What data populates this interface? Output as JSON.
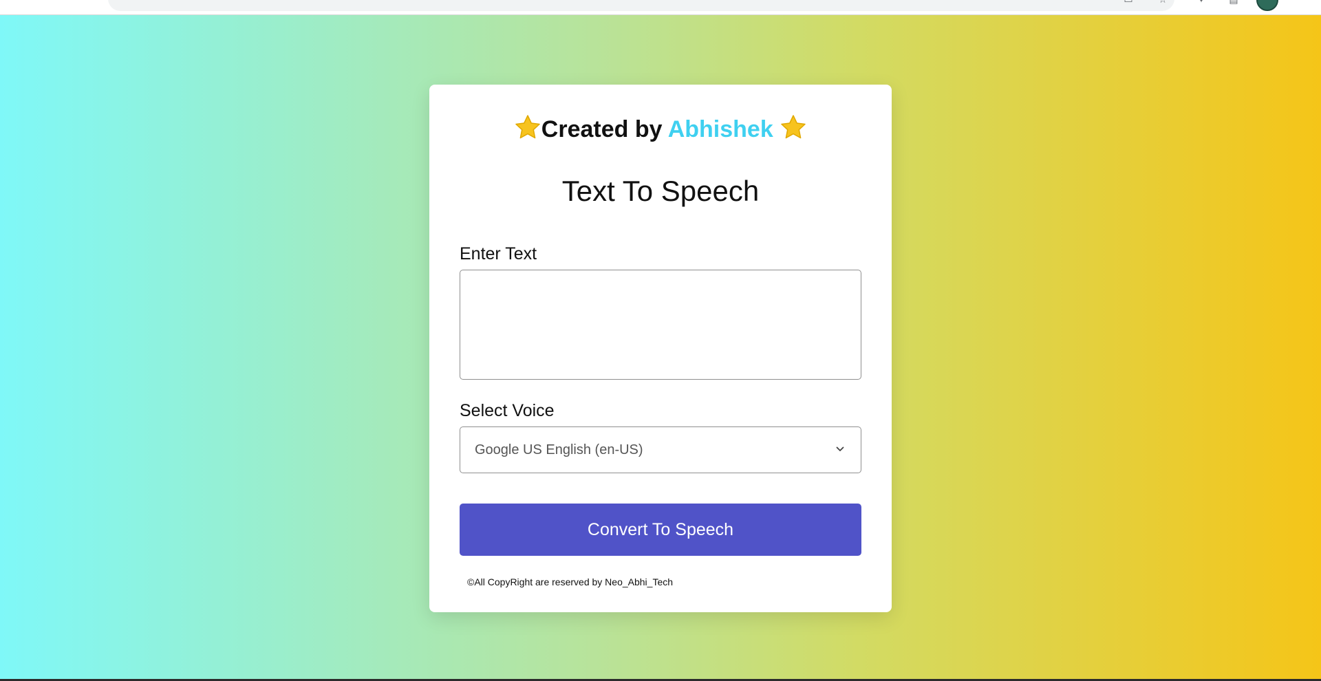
{
  "browser": {
    "icon_names": [
      "extension-icon",
      "puzzle-icon",
      "sidebar-icon",
      "profile-avatar"
    ]
  },
  "card": {
    "credit_prefix": "Created by",
    "credit_author": "Abhishek",
    "star_icon": "star-icon",
    "title": "Text To Speech",
    "text_label": "Enter Text",
    "text_value": "",
    "voice_label": "Select Voice",
    "voice_selected": "Google US English (en-US)",
    "button_label": "Convert To Speech",
    "copyright": "©All CopyRight are reserved by Neo_Abhi_Tech"
  },
  "colors": {
    "gradient_start": "#7ff8f8",
    "gradient_end": "#f5c518",
    "author_accent": "#3fd0f0",
    "button": "#5053c8",
    "star": "#f7c31e"
  }
}
